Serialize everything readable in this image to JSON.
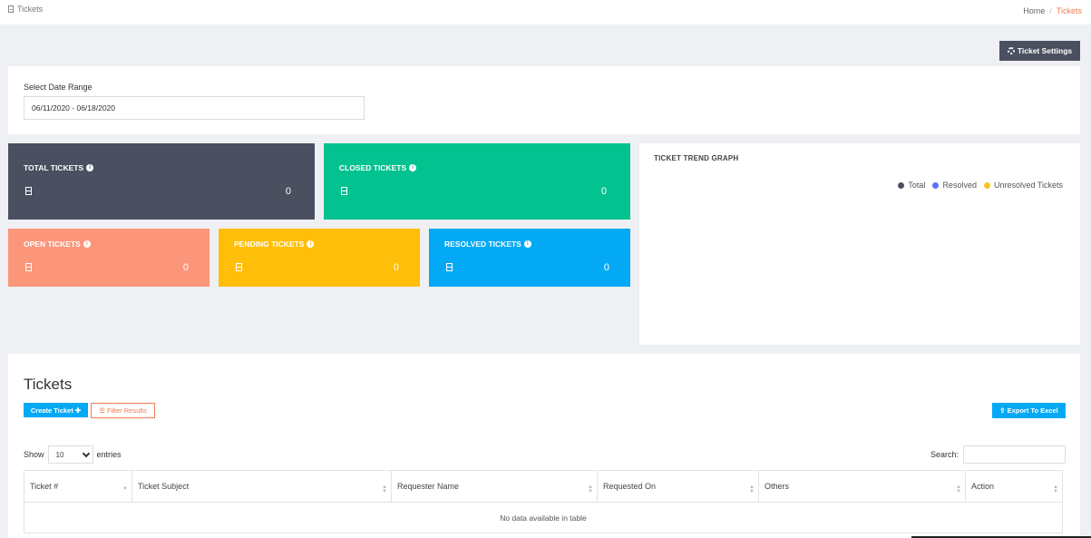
{
  "header": {
    "page_label": "Tickets",
    "breadcrumb": {
      "home": "Home",
      "separator": "/",
      "current": "Tickets"
    }
  },
  "toolbar": {
    "settings_label": "Ticket Settings"
  },
  "date_range": {
    "label": "Select Date Range",
    "value": "06/11/2020 - 06/18/2020"
  },
  "stats": {
    "total": {
      "title": "TOTAL TICKETS",
      "count": "0",
      "color": "#4a5060"
    },
    "closed": {
      "title": "CLOSED TICKETS",
      "count": "0",
      "color": "#02c290"
    },
    "open": {
      "title": "OPEN TICKETS",
      "count": "0",
      "color": "#fb967a"
    },
    "pending": {
      "title": "PENDING TICKETS",
      "count": "0",
      "color": "#ffbe0a"
    },
    "resolved": {
      "title": "RESOLVED TICKETS",
      "count": "0",
      "color": "#03a9f4"
    }
  },
  "trend": {
    "title": "TICKET TREND GRAPH",
    "legend": [
      {
        "label": "Total",
        "color": "#4a5060"
      },
      {
        "label": "Resolved",
        "color": "#5b6ff5"
      },
      {
        "label": "Unresolved Tickets",
        "color": "#f5c518"
      }
    ]
  },
  "tickets": {
    "heading": "Tickets",
    "create_label": "Create Ticket",
    "filter_label": "Filter Results",
    "export_label": "Export To Excel",
    "show_label": "Show",
    "entries_value": "10",
    "entries_label": "entries",
    "search_label": "Search:",
    "columns": [
      "Ticket #",
      "Ticket Subject",
      "Requester Name",
      "Requested On",
      "Others",
      "Action"
    ],
    "empty_message": "No data available in table"
  }
}
